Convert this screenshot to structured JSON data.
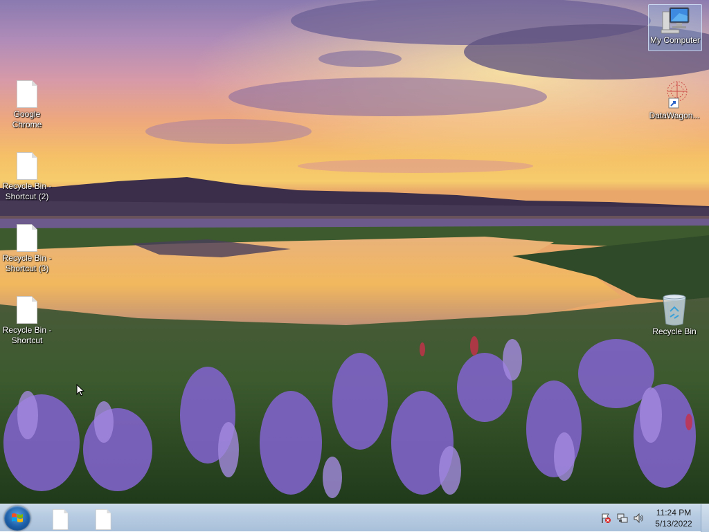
{
  "desktop": {
    "icons_left": [
      {
        "label_line1": "Google",
        "label_line2": "Chrome",
        "icon": "blank-file-icon"
      },
      {
        "label_line1": "Recycle Bin -",
        "label_line2": "Shortcut (2)",
        "icon": "blank-file-icon"
      },
      {
        "label_line1": "Recycle Bin -",
        "label_line2": "Shortcut (3)",
        "icon": "blank-file-icon"
      },
      {
        "label_line1": "Recycle Bin -",
        "label_line2": "Shortcut",
        "icon": "blank-file-icon"
      }
    ],
    "icons_right": [
      {
        "label": "My Computer",
        "icon": "computer-icon",
        "selected": true
      },
      {
        "label": "DataWagon...",
        "icon": "datawagon-icon"
      },
      {
        "label": "Recycle Bin",
        "icon": "recycle-bin-icon"
      }
    ]
  },
  "taskbar": {
    "start_icon": "windows-orb-icon",
    "pinned": [
      {
        "icon": "blank-file-icon"
      },
      {
        "icon": "blank-file-icon"
      }
    ],
    "tray": {
      "icons": [
        "action-center-flag-icon",
        "network-icon",
        "volume-icon"
      ],
      "time": "11:24 PM",
      "date": "5/13/2022"
    }
  },
  "colors": {
    "taskbar": "#b6cbe1",
    "sky_top": "#8a7ab0",
    "sunset": "#f5c067",
    "flowers": "#7f63c8"
  }
}
